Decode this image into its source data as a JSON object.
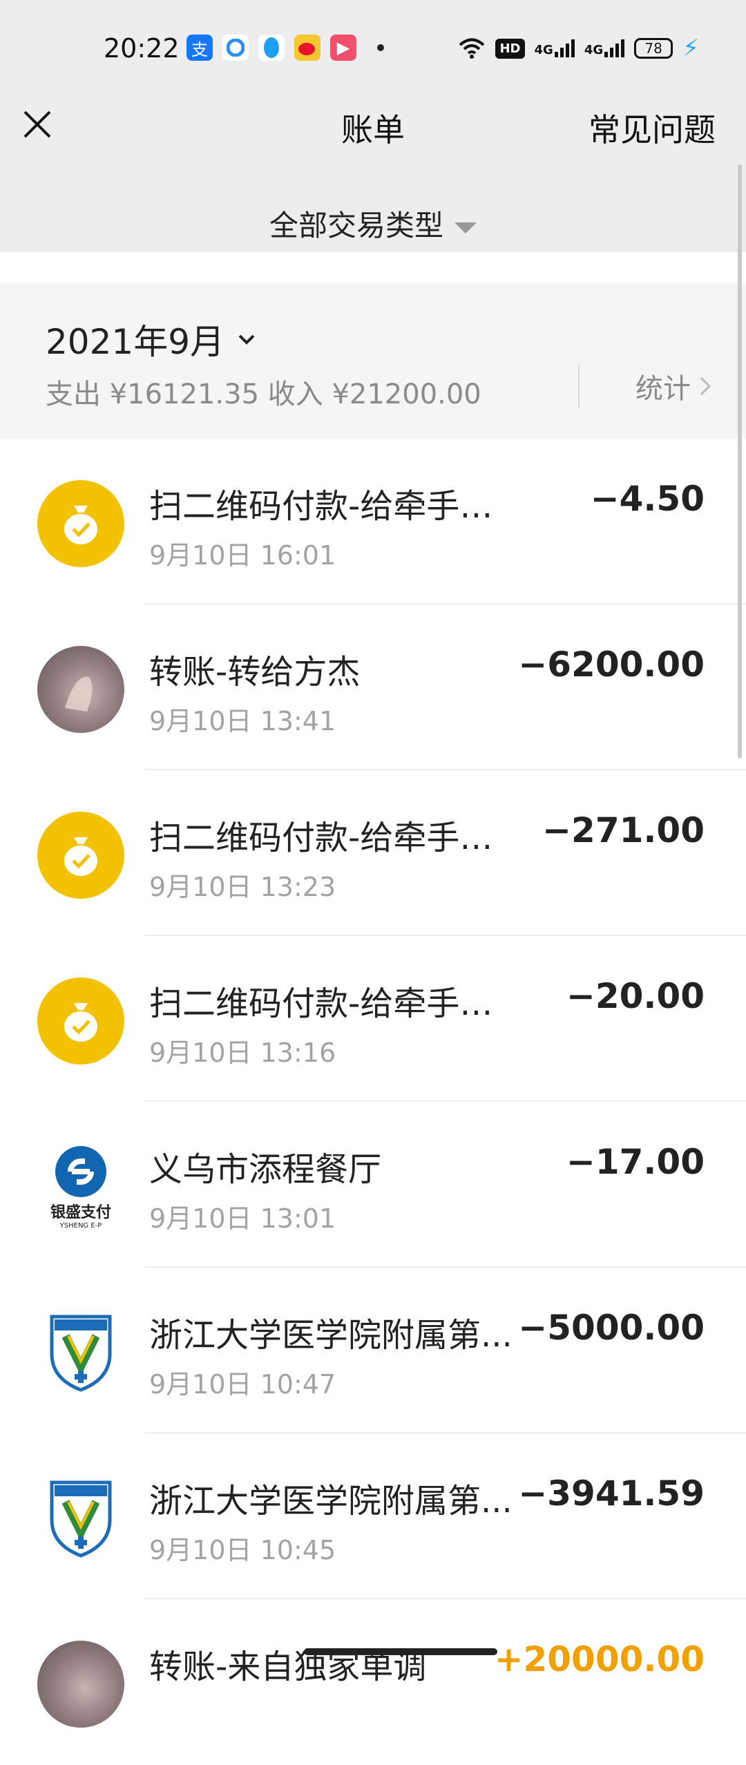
{
  "status_bar": {
    "time": "20:22",
    "network_1": "4G",
    "network_2": "4G",
    "hd_badge": "HD",
    "battery": "78"
  },
  "header": {
    "title": "账单",
    "faq_label": "常见问题",
    "filter_label": "全部交易类型"
  },
  "summary": {
    "month": "2021年9月",
    "totals": "支出 ¥16121.35 收入 ¥21200.00",
    "stats_label": "统计"
  },
  "transactions": [
    {
      "title": "扫二维码付款-给牵手看...",
      "time": "9月10日 16:01",
      "amount": "−4.50",
      "icon": "money-bag-icon"
    },
    {
      "title": "转账-转给方杰",
      "time": "9月10日 13:41",
      "amount": "−6200.00",
      "icon": "user-photo-avatar"
    },
    {
      "title": "扫二维码付款-给牵手看...",
      "time": "9月10日 13:23",
      "amount": "−271.00",
      "icon": "money-bag-icon"
    },
    {
      "title": "扫二维码付款-给牵手看...",
      "time": "9月10日 13:16",
      "amount": "−20.00",
      "icon": "money-bag-icon"
    },
    {
      "title": "义乌市添程餐厅",
      "time": "9月10日 13:01",
      "amount": "−17.00",
      "icon": "yinsheng-pay-logo",
      "logo_text": "银盛支付",
      "logo_subtext": "YSHENG E-P"
    },
    {
      "title": "浙江大学医学院附属第...",
      "time": "9月10日 10:47",
      "amount": "−5000.00",
      "icon": "hospital-shield-logo"
    },
    {
      "title": "浙江大学医学院附属第...",
      "time": "9月10日 10:45",
      "amount": "−3941.59",
      "icon": "hospital-shield-logo"
    },
    {
      "title": "转账-来自独家单调",
      "time": "",
      "amount": "+20000.00",
      "icon": "user-photo-avatar",
      "income": true
    }
  ],
  "colors": {
    "header_bg": "#ededed",
    "summary_bg": "#f5f5f5",
    "yellow_icon": "#f2c200",
    "income": "#f0a000",
    "muted_text": "#a3a3a3"
  }
}
